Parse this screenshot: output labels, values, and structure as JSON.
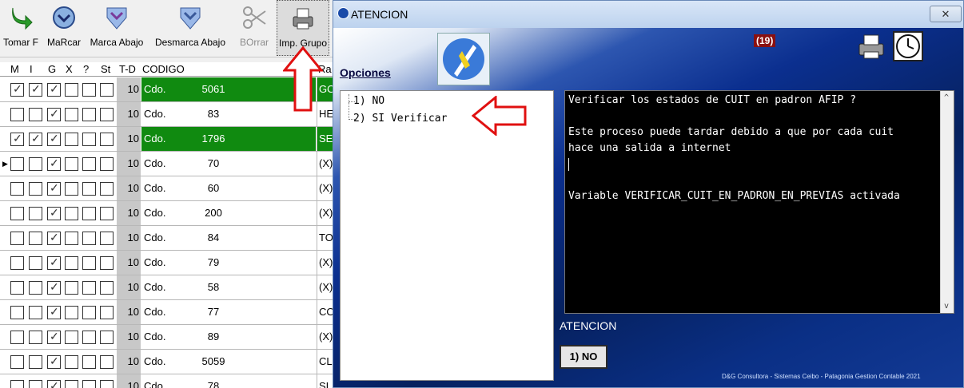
{
  "toolbar": {
    "buttons": [
      {
        "label": "Tomar F",
        "icon": "green-arrow-icon"
      },
      {
        "label": "MaRcar",
        "icon": "check-circle-icon"
      },
      {
        "label": "Marca Abajo",
        "icon": "mark-down-icon"
      },
      {
        "label": "Desmarca Abajo",
        "icon": "unmark-down-icon"
      },
      {
        "label": "BOrrar",
        "icon": "scissors-icon"
      },
      {
        "label": "Imp. Grupo",
        "icon": "printer-icon"
      }
    ]
  },
  "grid": {
    "headers": [
      "M",
      "I",
      "G",
      "X",
      "?",
      "St",
      "T-D",
      "CODIGO",
      "Ra"
    ],
    "rows": [
      {
        "m": true,
        "i": true,
        "g": true,
        "x": false,
        "q": false,
        "st": false,
        "td": "10",
        "code": "Cdo.",
        "num": "5061",
        "rz": "GO",
        "green": true
      },
      {
        "m": false,
        "i": false,
        "g": true,
        "x": false,
        "q": false,
        "st": false,
        "td": "10",
        "code": "Cdo.",
        "num": "83",
        "rz": "HE",
        "green": false
      },
      {
        "m": true,
        "i": true,
        "g": true,
        "x": false,
        "q": false,
        "st": false,
        "td": "10",
        "code": "Cdo.",
        "num": "1796",
        "rz": "SE",
        "green": true
      },
      {
        "m": false,
        "i": false,
        "g": true,
        "x": false,
        "q": false,
        "st": false,
        "td": "10",
        "code": "Cdo.",
        "num": "70",
        "rz": "(X)",
        "green": false,
        "current": true
      },
      {
        "m": false,
        "i": false,
        "g": true,
        "x": false,
        "q": false,
        "st": false,
        "td": "10",
        "code": "Cdo.",
        "num": "60",
        "rz": "(X)",
        "green": false
      },
      {
        "m": false,
        "i": false,
        "g": true,
        "x": false,
        "q": false,
        "st": false,
        "td": "10",
        "code": "Cdo.",
        "num": "200",
        "rz": "(X)",
        "green": false
      },
      {
        "m": false,
        "i": false,
        "g": true,
        "x": false,
        "q": false,
        "st": false,
        "td": "10",
        "code": "Cdo.",
        "num": "84",
        "rz": "TO",
        "green": false
      },
      {
        "m": false,
        "i": false,
        "g": true,
        "x": false,
        "q": false,
        "st": false,
        "td": "10",
        "code": "Cdo.",
        "num": "79",
        "rz": "(X)",
        "green": false
      },
      {
        "m": false,
        "i": false,
        "g": true,
        "x": false,
        "q": false,
        "st": false,
        "td": "10",
        "code": "Cdo.",
        "num": "58",
        "rz": "(X)",
        "green": false
      },
      {
        "m": false,
        "i": false,
        "g": true,
        "x": false,
        "q": false,
        "st": false,
        "td": "10",
        "code": "Cdo.",
        "num": "77",
        "rz": "CO",
        "green": false
      },
      {
        "m": false,
        "i": false,
        "g": true,
        "x": false,
        "q": false,
        "st": false,
        "td": "10",
        "code": "Cdo.",
        "num": "89",
        "rz": "(X)",
        "green": false
      },
      {
        "m": false,
        "i": false,
        "g": true,
        "x": false,
        "q": false,
        "st": false,
        "td": "10",
        "code": "Cdo.",
        "num": "5059",
        "rz": "CL",
        "green": false
      },
      {
        "m": false,
        "i": false,
        "g": true,
        "x": false,
        "q": false,
        "st": false,
        "td": "10",
        "code": "Cdo.",
        "num": "78",
        "rz": "SI",
        "green": false
      }
    ]
  },
  "dialog": {
    "title": "ATENCION",
    "close_label": "✕",
    "opciones_label": "Opciones",
    "counter": "(19)",
    "options": [
      "1) NO",
      "2) SI Verificar"
    ],
    "message_lines": [
      "Verificar los estados de CUIT en padron AFIP ?",
      "",
      "Este proceso puede tardar debido a que por cada cuit",
      "hace una salida a internet",
      "",
      "",
      "Variable VERIFICAR_CUIT_EN_PADRON_EN_PREVIAS activada"
    ],
    "atencion_label": "ATENCION",
    "no_button": "1) NO",
    "footer": "D&G Consultora - Sistemas Ceibo - Patagonia Gestion Contable 2021"
  },
  "colors": {
    "green_row": "#108a10",
    "dialog_bg": "#0a2a7a",
    "arrow": "#e01010"
  }
}
